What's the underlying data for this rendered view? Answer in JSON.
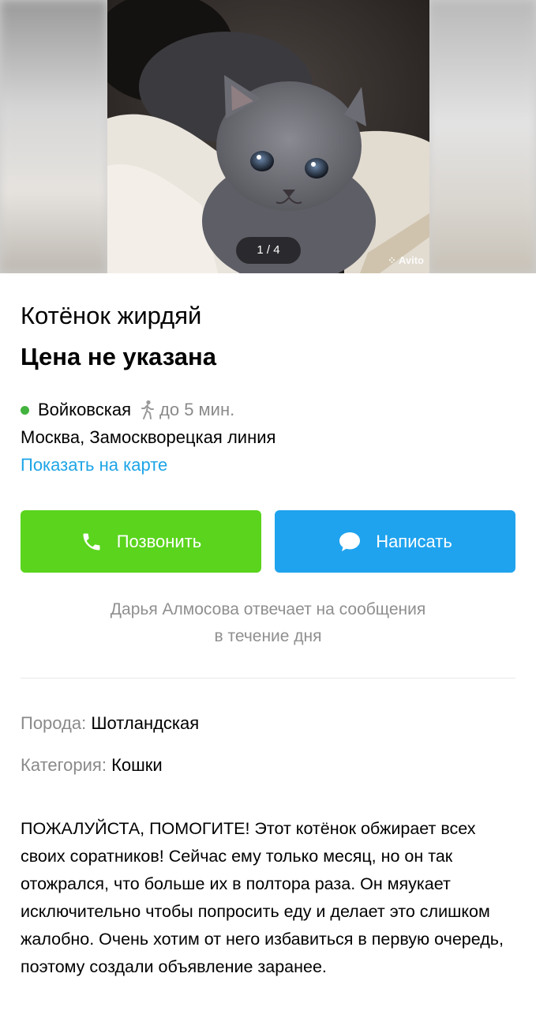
{
  "gallery": {
    "counter": "1 / 4",
    "watermark": "Avito",
    "photo_alt": "kitten-photo"
  },
  "listing": {
    "title": "Котёнок жирдяй",
    "price": "Цена не указана"
  },
  "location": {
    "metro_station": "Войковская",
    "metro_color": "#42b33e",
    "walk_time": "до 5 мин.",
    "address": "Москва, Замоскворецкая линия",
    "map_link": "Показать на карте"
  },
  "actions": {
    "call_label": "Позвонить",
    "message_label": "Написать"
  },
  "seller": {
    "reply_line1": "Дарья Алмосова отвечает на сообщения",
    "reply_line2": "в течение дня"
  },
  "params": [
    {
      "key": "Порода:",
      "value": "Шотландская"
    },
    {
      "key": "Категория:",
      "value": "Кошки"
    }
  ],
  "description": "ПОЖАЛУЙСТА, ПОМОГИТЕ! Этот котёнок обжирает всех своих соратников! Сейчас ему только месяц, но он так отожрался, что больше их в полтора раза. Он мяукает исключительно чтобы попросить еду и делает это слишком жалобно. Очень хотим от него избавиться в первую очередь, поэтому создали объявление заранее."
}
